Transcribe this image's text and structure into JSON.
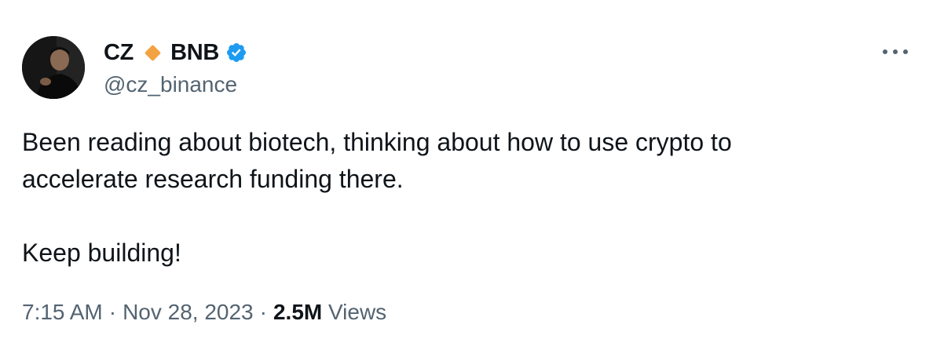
{
  "author": {
    "name_part1": "CZ",
    "name_part2": "BNB",
    "handle": "@cz_binance"
  },
  "tweet": {
    "line1": "Been reading about biotech, thinking about how to use crypto to",
    "line2": "accelerate research funding there.",
    "line3": "Keep building!"
  },
  "meta": {
    "time": "7:15 AM",
    "separator": "·",
    "date": "Nov 28, 2023",
    "views_count": "2.5M",
    "views_label": "Views"
  },
  "colors": {
    "diamond": "#F3A341",
    "verified": "#1D9BF0",
    "secondary_text": "#536471",
    "primary_text": "#0F1419"
  },
  "icons": {
    "diamond": "orange-diamond-icon",
    "verified": "verified-badge-icon",
    "more": "more-options-icon"
  }
}
